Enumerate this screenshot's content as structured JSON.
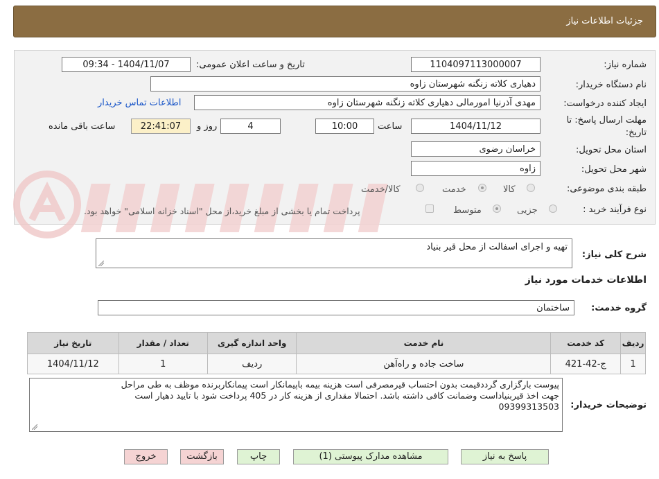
{
  "header": {
    "title": "جزئیات اطلاعات نیاز"
  },
  "form": {
    "need_number_label": "شماره نیاز:",
    "need_number": "1104097113000007",
    "announce_label": "تاریخ و ساعت اعلان عمومی:",
    "announce_value": "1404/11/07 - 09:34",
    "buyer_org_label": "نام دستگاه خریدار:",
    "buyer_org": "دهیاری کلاته زنگنه شهرستان زاوه",
    "creator_label": "ایجاد کننده درخواست:",
    "creator": "مهدی آذرنیا امورمالی دهیاری کلاته زنگنه شهرستان زاوه",
    "contact_link": "اطلاعات تماس خریدار",
    "deadline_label_1": "مهلت ارسال پاسخ: تا",
    "deadline_label_2": "تاریخ:",
    "deadline_date": "1404/11/12",
    "time_label": "ساعت",
    "deadline_time": "10:00",
    "days_value": "4",
    "days_label": "روز و",
    "remaining_time": "22:41:07",
    "remaining_label": "ساعت باقی مانده",
    "province_label": "استان محل تحویل:",
    "province": "خراسان رضوی",
    "city_label": "شهر محل تحویل:",
    "city": "زاوه",
    "category_label": "طبقه بندی موضوعی:",
    "category_options": [
      "کالا",
      "خدمت",
      "کالا/خدمت"
    ],
    "category_selected": "خدمت",
    "process_label": "نوع فرآیند خرید :",
    "process_options": [
      "جزیی",
      "متوسط"
    ],
    "process_selected": "متوسط",
    "treasury_note": "پرداخت تمام یا بخشی از مبلغ خرید،از محل \"اسناد خزانه اسلامی\" خواهد بود."
  },
  "description": {
    "label": "شرح کلی نیاز:",
    "value": "تهیه و اجرای اسفالت از محل قیر بنیاد"
  },
  "services": {
    "section_title": "اطلاعات خدمات مورد نیاز",
    "group_label": "گروه خدمت:",
    "group_value": "ساختمان",
    "columns": [
      "ردیف",
      "کد خدمت",
      "نام خدمت",
      "واحد اندازه گیری",
      "تعداد / مقدار",
      "تاریخ نیاز"
    ],
    "rows": [
      [
        "1",
        "ج-42-421",
        "ساخت جاده و راه‌آهن",
        "ردیف",
        "1",
        "1404/11/12"
      ]
    ]
  },
  "buyer_notes": {
    "label": "توضیحات خریدار:",
    "line1": "پیوست بارگزاری گرددقیمت بدون احتساب قیرمصرفی است هزینه بیمه باپیمانکار است پیمانکاربرنده موظف به طی مراحل",
    "line2": "جهت اخذ قیربنیاداست وضمانت کافی داشته باشد.  احتمالا مقداری از هزینه کار در 405 پرداخت شود با تایید دهیار است",
    "line3": "09399313503"
  },
  "buttons": {
    "respond": "پاسخ به نیاز",
    "attachments": "مشاهده مدارک پیوستی (1)",
    "print": "چاپ",
    "back": "بازگشت",
    "exit": "خروج"
  },
  "colors": {
    "header_bg": "#8b6d42",
    "time_box_bg": "#fcf0c8",
    "link": "#1a56c8",
    "button_green": "#dff3d4",
    "button_pink": "#f5d3d3"
  }
}
